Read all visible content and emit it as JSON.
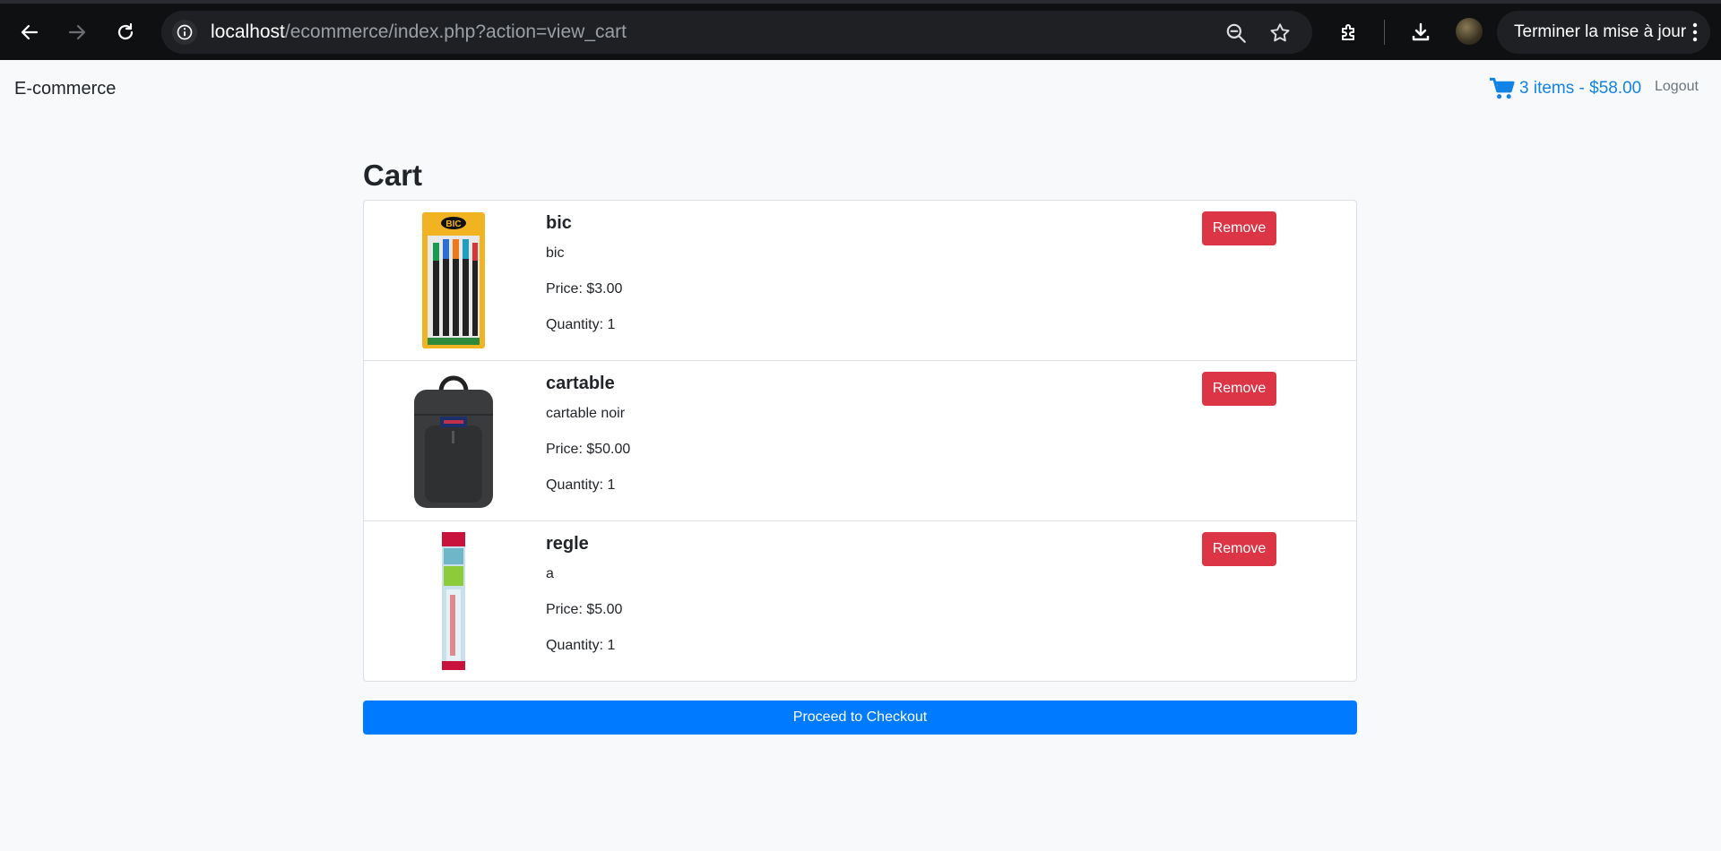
{
  "browser": {
    "url_host": "localhost",
    "url_path": "/ecommerce/index.php?action=view_cart",
    "update_label": "Terminer la mise à jour"
  },
  "navbar": {
    "brand": "E-commerce",
    "cart_summary": "3 items - $58.00",
    "logout": "Logout"
  },
  "cart": {
    "title": "Cart",
    "items": [
      {
        "name": "bic",
        "description": "bic",
        "price": "Price: $3.00",
        "quantity": "Quantity: 1",
        "remove_label": "Remove",
        "image": "mechanical-pencils-pack"
      },
      {
        "name": "cartable",
        "description": "cartable noir",
        "price": "Price: $50.00",
        "quantity": "Quantity: 1",
        "remove_label": "Remove",
        "image": "black-backpack"
      },
      {
        "name": "regle",
        "description": "a",
        "price": "Price: $5.00",
        "quantity": "Quantity: 1",
        "remove_label": "Remove",
        "image": "ruler-package"
      }
    ],
    "checkout_label": "Proceed to Checkout"
  },
  "colors": {
    "primary": "#007bff",
    "danger": "#dc3545",
    "link": "#1283e6"
  }
}
